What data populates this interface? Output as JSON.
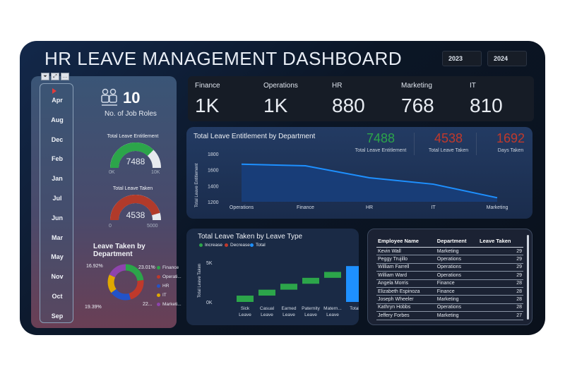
{
  "title": "HR LEAVE MANAGEMENT DASHBOARD",
  "years": [
    "2023",
    "2024"
  ],
  "toolbar_icons": [
    "filter-icon",
    "expand-icon",
    "more-icon"
  ],
  "months": [
    "Apr",
    "Aug",
    "Dec",
    "Feb",
    "Jan",
    "Jul",
    "Jun",
    "Mar",
    "May",
    "Nov",
    "Oct",
    "Sep"
  ],
  "job_roles": {
    "value": "10",
    "label": "No. of Job Roles"
  },
  "gauge_entitlement": {
    "title": "Total Leave Entitlement",
    "value": "7488",
    "min": "0K",
    "max": "10K",
    "fraction": 0.7488,
    "color": "#2ca54a"
  },
  "gauge_taken": {
    "title": "Total Leave Taken",
    "value": "4538",
    "min": "0",
    "max": "5000",
    "fraction": 0.9076,
    "color": "#b13a2a"
  },
  "donut": {
    "title": "Leave Taken by Department",
    "labels": {
      "a": "16.92%",
      "b": "23.01%",
      "c": "19.39%",
      "d": "22..."
    },
    "legend": [
      {
        "name": "Finance",
        "color": "#2ca54a"
      },
      {
        "name": "Operati...",
        "color": "#c0392b"
      },
      {
        "name": "HR",
        "color": "#2353c8"
      },
      {
        "name": "IT",
        "color": "#e0a800"
      },
      {
        "name": "Marketi...",
        "color": "#8e44ad"
      }
    ]
  },
  "dept_kpis": [
    {
      "name": "Finance",
      "value": "1K"
    },
    {
      "name": "Operations",
      "value": "1K"
    },
    {
      "name": "HR",
      "value": "880"
    },
    {
      "name": "Marketing",
      "value": "768"
    },
    {
      "name": "IT",
      "value": "810"
    }
  ],
  "summary_kpis": [
    {
      "value": "7488",
      "label": "Total Leave Entitlement",
      "color": "#2ca54a"
    },
    {
      "value": "4538",
      "label": "Total Leave Taken",
      "color": "#c0392b"
    },
    {
      "value": "1692",
      "label": "Days Taken",
      "color": "#c0392b"
    }
  ],
  "line_chart": {
    "title": "Total Leave Entitlement by Department",
    "ylabel": "Total Leave Entitlement"
  },
  "waterfall": {
    "title": "Total Leave Taken by Leave Type",
    "ylabel": "Total Leave Taken",
    "legend": [
      {
        "name": "Increase",
        "color": "#2ca54a"
      },
      {
        "name": "Decrease",
        "color": "#c0392b"
      },
      {
        "name": "Total",
        "color": "#1e90ff"
      }
    ]
  },
  "chart_data": [
    {
      "type": "area",
      "categories": [
        "Operations",
        "Finance",
        "HR",
        "IT",
        "Marketing"
      ],
      "values": [
        1670,
        1650,
        1500,
        1420,
        1250
      ],
      "ylim": [
        1200,
        1800
      ],
      "yticks": [
        "1800",
        "1600",
        "1400",
        "1200"
      ],
      "color": "#1e90ff"
    },
    {
      "type": "bar",
      "subtype": "waterfall",
      "categories": [
        "Sick Leave",
        "Casual Leave",
        "Earned Leave",
        "Paternity Leave",
        "Matern... Leave",
        "Total"
      ],
      "category_lines": [
        [
          "Sick",
          "Leave"
        ],
        [
          "Casual",
          "Leave"
        ],
        [
          "Earned",
          "Leave"
        ],
        [
          "Paternity",
          "Leave"
        ],
        [
          "Matern...",
          "Leave"
        ],
        [
          "Total",
          ""
        ]
      ],
      "values": [
        800,
        750,
        750,
        750,
        750,
        4538
      ],
      "ylim": [
        0,
        5000
      ],
      "yticks": [
        "5K",
        "0K"
      ]
    }
  ],
  "table": {
    "headers": [
      "Employee Name",
      "Department",
      "Leave Taken"
    ],
    "rows": [
      [
        "Kevin Wall",
        "Marketing",
        "29"
      ],
      [
        "Peggy Trujillo",
        "Operations",
        "29"
      ],
      [
        "William Farrell",
        "Operations",
        "29"
      ],
      [
        "William Ward",
        "Operations",
        "29"
      ],
      [
        "Angela Morris",
        "Finance",
        "28"
      ],
      [
        "Elizabeth Espinoza",
        "Finance",
        "28"
      ],
      [
        "Joseph Wheeler",
        "Marketing",
        "28"
      ],
      [
        "Kathryn Hobbs",
        "Operations",
        "28"
      ],
      [
        "Jeffery Forbes",
        "Marketing",
        "27"
      ]
    ]
  }
}
